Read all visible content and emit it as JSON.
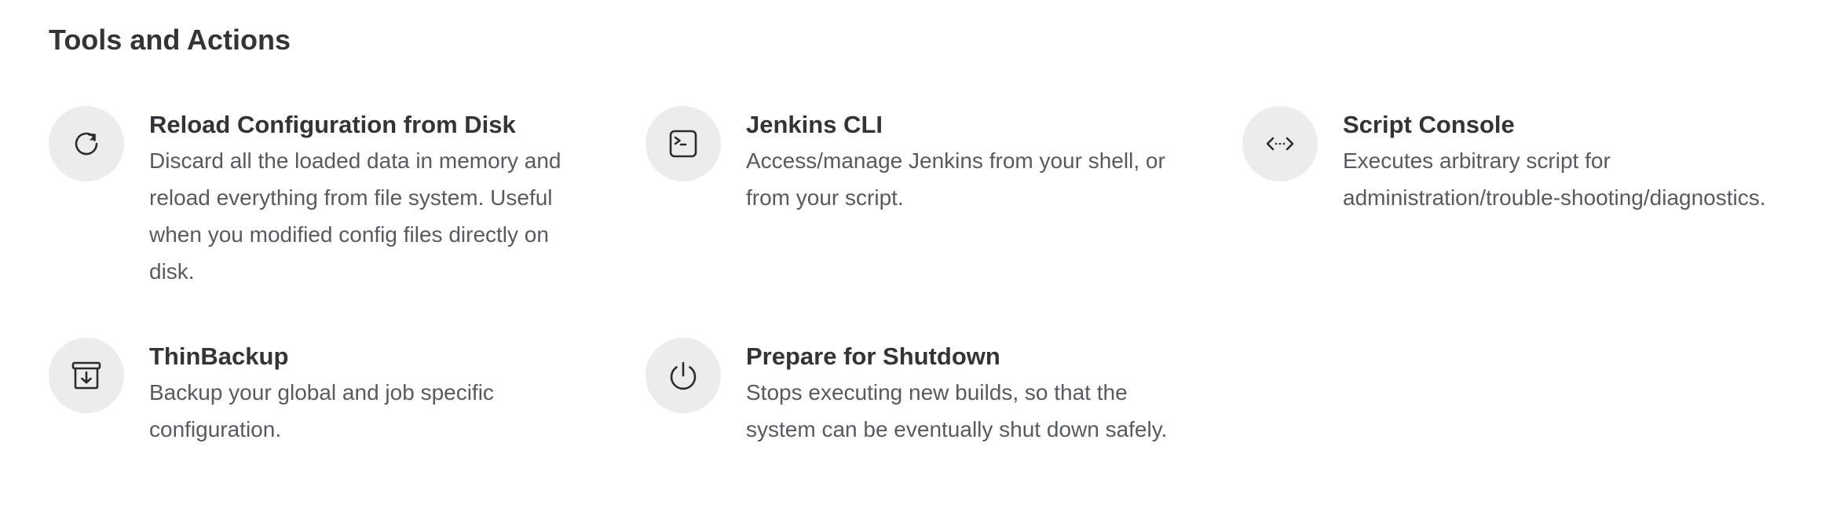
{
  "section": {
    "title": "Tools and Actions"
  },
  "items": [
    {
      "title": "Reload Configuration from Disk",
      "description": "Discard all the loaded data in memory and reload everything from file system. Useful when you modified config files directly on disk.",
      "icon": "reload-icon"
    },
    {
      "title": "Jenkins CLI",
      "description": "Access/manage Jenkins from your shell, or from your script.",
      "icon": "terminal-icon"
    },
    {
      "title": "Script Console",
      "description": "Executes arbitrary script for administration/trouble-shooting/diagnostics.",
      "icon": "code-icon"
    },
    {
      "title": "ThinBackup",
      "description": "Backup your global and job specific configuration.",
      "icon": "archive-download-icon"
    },
    {
      "title": "Prepare for Shutdown",
      "description": "Stops executing new builds, so that the system can be eventually shut down safely.",
      "icon": "power-icon"
    }
  ],
  "colors": {
    "icon_background": "#ececee",
    "title_text": "#333338",
    "description_text": "#565a61"
  }
}
